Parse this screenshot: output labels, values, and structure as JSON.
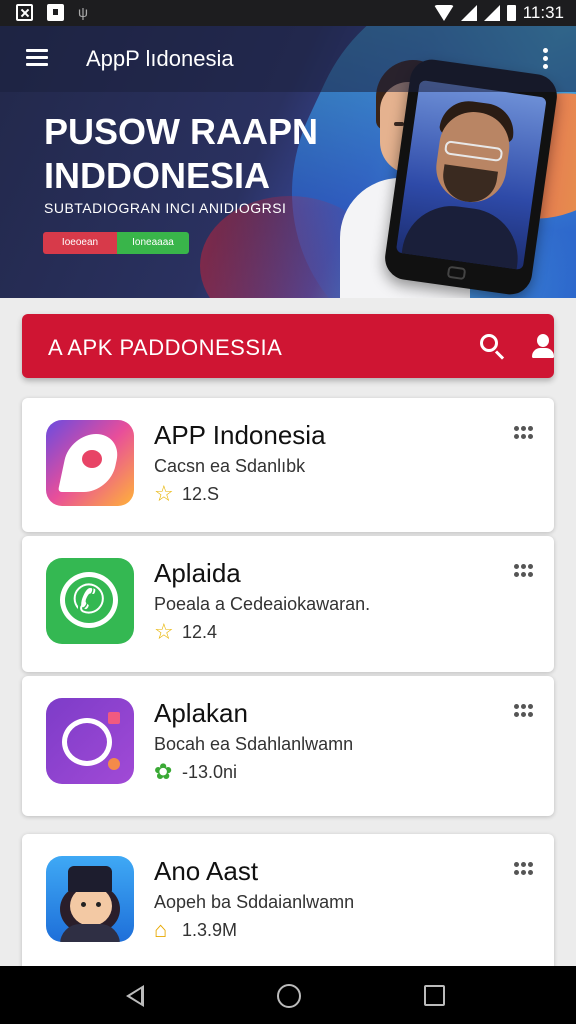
{
  "status_bar": {
    "time": "11:31",
    "icons": [
      "image-icon",
      "notification-icon",
      "usb-icon",
      "wifi-icon",
      "signal-icon",
      "battery-icon"
    ]
  },
  "app_bar": {
    "title": "AppP lıdonesia",
    "menu_icon": "hamburger-icon",
    "overflow_icon": "kebab-icon"
  },
  "banner": {
    "headline_line1": "PUSOW RAAPN",
    "headline_line2": "INDDONESIA",
    "subline": "SUBTADIOGRAN INCI ANIDIOGRSI",
    "pill_red": "Ioeoean",
    "pill_green": "Ioneaaaa"
  },
  "search_bar": {
    "title": "A APK PADDONESSIA",
    "search_icon": "search-icon",
    "account_icon": "user-icon",
    "color": "#cf1533"
  },
  "apps": [
    {
      "name": "APP Indonesia",
      "desc": "Cacsn ea Sdanlıbk",
      "rating": "12.S",
      "rate_icon": "star-icon"
    },
    {
      "name": "Aplaida",
      "desc": "Poeala a Cedeaiokawaran.",
      "rating": "12.4",
      "rate_icon": "star-icon"
    },
    {
      "name": "Aplakan",
      "desc": "Bocah ea Sdahlanlwamn",
      "rating": "-13.0ni",
      "rate_icon": "leaf-icon"
    },
    {
      "name": "Ano Aast",
      "desc": "Aopeh ba Sddaianlwamn",
      "rating": "1.3.9M",
      "rate_icon": "house-icon"
    }
  ],
  "nav_bar": {
    "icons": [
      "back-icon",
      "home-icon",
      "recents-icon"
    ]
  }
}
